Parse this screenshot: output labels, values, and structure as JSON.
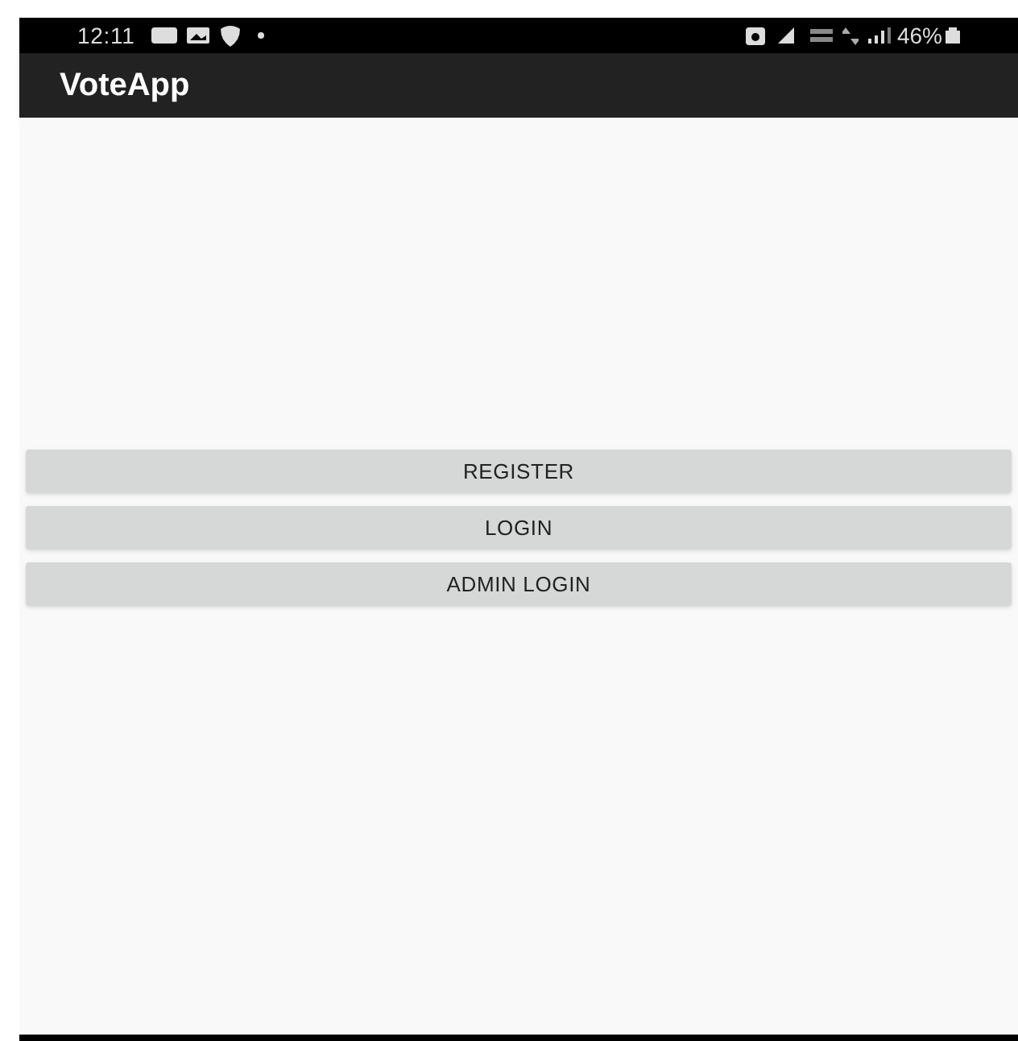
{
  "status_bar": {
    "time": "12:11",
    "battery": "46%"
  },
  "app_bar": {
    "title": "VoteApp"
  },
  "buttons": [
    {
      "label": "REGISTER"
    },
    {
      "label": "LOGIN"
    },
    {
      "label": "ADMIN LOGIN"
    }
  ]
}
